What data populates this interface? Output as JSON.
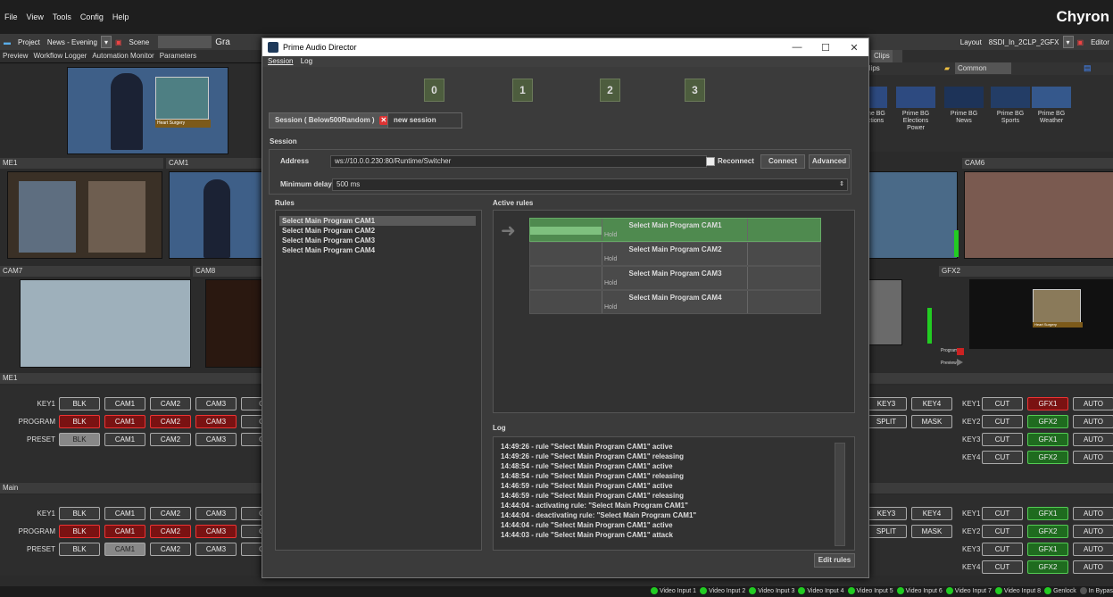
{
  "app": {
    "brand": "Chyron",
    "menu": [
      "File",
      "View",
      "Tools",
      "Config",
      "Help"
    ],
    "toolbar": {
      "project_label": "Project",
      "project_value": "News - Evening",
      "scene_label": "Scene",
      "gra_partial": "Gra",
      "layout_label": "Layout",
      "layout_value": "8SDI_In_2CLP_2GFX",
      "editor_label": "Editor"
    },
    "tabs": [
      "Preview",
      "Workflow Logger",
      "Automation Monitor",
      "Parameters"
    ],
    "right_tabs": [
      "s",
      "Clips"
    ],
    "clips": {
      "header": "Clips",
      "common": "Common",
      "items": [
        [
          "me BG",
          "ctions"
        ],
        [
          "Prime BG",
          "Elections",
          "Power"
        ],
        [
          "Prime BG",
          "News"
        ],
        [
          "Prime BG",
          "Sports"
        ],
        [
          "Prime BG",
          "Weather"
        ]
      ]
    },
    "thumb_caption": "Heart Surgery",
    "panels": {
      "me1": "ME1",
      "cam1": "CAM1",
      "cam6": "CAM6",
      "cam7": "CAM7",
      "cam8": "CAM8",
      "gfx2": "GFX2",
      "program": "Program",
      "preview": "Preview"
    },
    "switchers": [
      {
        "title": "ME1",
        "rows": [
          {
            "label": "KEY1",
            "buttons": [
              "BLK",
              "CAM1",
              "CAM2",
              "CAM3",
              "C"
            ]
          },
          {
            "label": "PROGRAM",
            "buttons": [
              "BLK",
              "CAM1",
              "CAM2",
              "CAM3",
              "C"
            ]
          },
          {
            "label": "PRESET",
            "buttons": [
              "BLK",
              "CAM1",
              "CAM2",
              "CAM3",
              "C"
            ]
          }
        ],
        "right_rows": [
          [
            "KEY3",
            "KEY4"
          ],
          [
            "SPLIT",
            "MASK"
          ]
        ],
        "keys": [
          {
            "label": "KEY1",
            "buttons": [
              "CUT",
              "GFX1",
              "AUTO"
            ]
          },
          {
            "label": "KEY2",
            "buttons": [
              "CUT",
              "GFX2",
              "AUTO"
            ]
          },
          {
            "label": "KEY3",
            "buttons": [
              "CUT",
              "GFX1",
              "AUTO"
            ]
          },
          {
            "label": "KEY4",
            "buttons": [
              "CUT",
              "GFX2",
              "AUTO"
            ]
          }
        ]
      },
      {
        "title": "Main",
        "rows": [
          {
            "label": "KEY1",
            "buttons": [
              "BLK",
              "CAM1",
              "CAM2",
              "CAM3",
              "C"
            ]
          },
          {
            "label": "PROGRAM",
            "buttons": [
              "BLK",
              "CAM1",
              "CAM2",
              "CAM3",
              "C"
            ]
          },
          {
            "label": "PRESET",
            "buttons": [
              "BLK",
              "CAM1",
              "CAM2",
              "CAM3",
              "C"
            ]
          }
        ],
        "right_rows": [
          [
            "KEY3",
            "KEY4"
          ],
          [
            "SPLIT",
            "MASK"
          ]
        ],
        "keys": [
          {
            "label": "KEY1",
            "buttons": [
              "CUT",
              "GFX1",
              "AUTO"
            ]
          },
          {
            "label": "KEY2",
            "buttons": [
              "CUT",
              "GFX2",
              "AUTO"
            ]
          },
          {
            "label": "KEY3",
            "buttons": [
              "CUT",
              "GFX1",
              "AUTO"
            ]
          },
          {
            "label": "KEY4",
            "buttons": [
              "CUT",
              "GFX2",
              "AUTO"
            ]
          }
        ]
      }
    ],
    "status": [
      "Video Input 1",
      "Video Input 2",
      "Video Input 3",
      "Video Input 4",
      "Video Input 5",
      "Video Input 6",
      "Video Input 7",
      "Video Input 8",
      "Genlock",
      "In Bypas"
    ]
  },
  "dialog": {
    "title": "Prime Audio Director",
    "window_controls": [
      "—",
      "☐",
      "✕"
    ],
    "menu": [
      "Session",
      "Log"
    ],
    "channels": [
      "0",
      "1",
      "2",
      "3"
    ],
    "session_tabs": [
      "Session ( Below500Random )",
      "new session"
    ],
    "session_label": "Session",
    "address_label": "Address",
    "address_value": "ws://10.0.0.230:80/Runtime/Switcher",
    "reconnect_label": "Reconnect",
    "connect_label": "Connect",
    "advanced_label": "Advanced",
    "min_delay_label": "Minimum delay",
    "min_delay_value": "500 ms",
    "rules_label": "Rules",
    "rules": [
      "Select Main Program CAM1",
      "Select Main Program CAM2",
      "Select Main Program CAM3",
      "Select Main Program CAM4"
    ],
    "active_rules_label": "Active rules",
    "active_rules": [
      {
        "title": "Select Main Program CAM1",
        "state": "Hold",
        "active": true
      },
      {
        "title": "Select Main Program CAM2",
        "state": "Hold",
        "active": false
      },
      {
        "title": "Select Main Program CAM3",
        "state": "Hold",
        "active": false
      },
      {
        "title": "Select Main Program CAM4",
        "state": "Hold",
        "active": false
      }
    ],
    "log_label": "Log",
    "log": [
      "14:49:26 - rule \"Select Main Program CAM1\" active",
      "14:49:26 - rule \"Select Main Program CAM1\" releasing",
      "14:48:54 - rule \"Select Main Program CAM1\" active",
      "14:48:54 - rule \"Select Main Program CAM1\" releasing",
      "14:46:59 - rule \"Select Main Program CAM1\" active",
      "14:46:59 - rule \"Select Main Program CAM1\" releasing",
      "14:44:04 - activating rule: \"Select Main Program CAM1\"",
      "14:44:04 - deactivating rule: \"Select Main Program CAM1\"",
      "14:44:04 - rule \"Select Main Program CAM1\" active",
      "14:44:03 - rule \"Select Main Program CAM1\" attack"
    ],
    "edit_rules_label": "Edit rules"
  }
}
